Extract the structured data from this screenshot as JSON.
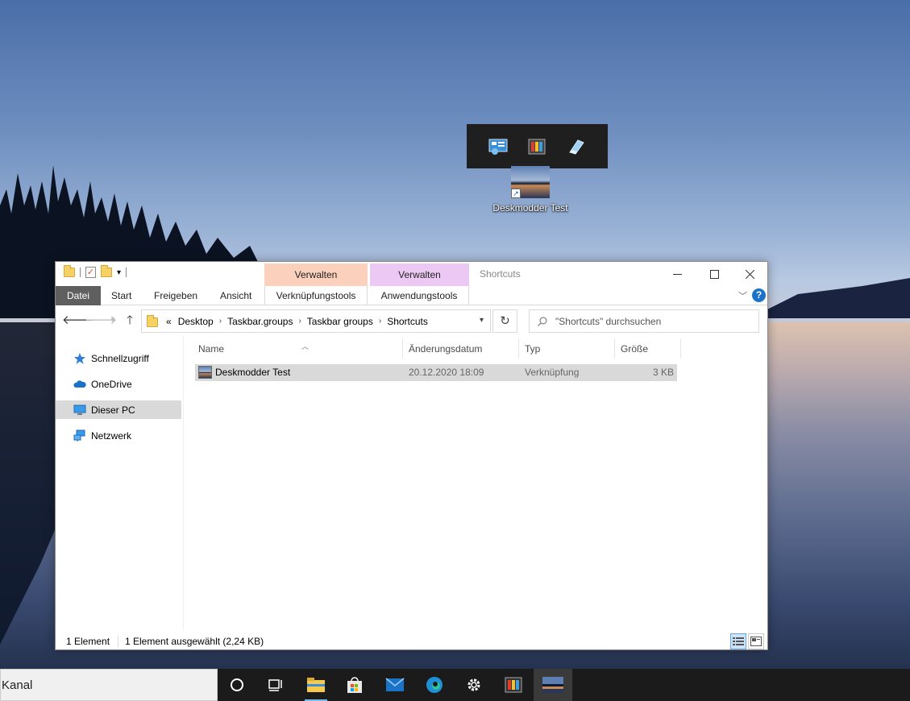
{
  "desktop": {
    "shortcut_label": "Deskmodder Test"
  },
  "window": {
    "title": "Shortcuts",
    "context_tabs": [
      {
        "header": "Verwalten",
        "label": "Verknüpfungstools",
        "color": "#fbd0bd"
      },
      {
        "header": "Verwalten",
        "label": "Anwendungstools",
        "color": "#ecc9f4"
      }
    ],
    "ribbon_tabs": [
      "Datei",
      "Start",
      "Freigeben",
      "Ansicht"
    ],
    "help": "?"
  },
  "address": {
    "prefix": "«",
    "crumbs": [
      "Desktop",
      "Taskbar.groups",
      "Taskbar groups",
      "Shortcuts"
    ]
  },
  "search": {
    "placeholder": "\"Shortcuts\" durchsuchen"
  },
  "sidebar": {
    "items": [
      {
        "label": "Schnellzugriff",
        "icon": "star-icon"
      },
      {
        "label": "OneDrive",
        "icon": "cloud-icon"
      },
      {
        "label": "Dieser PC",
        "icon": "computer-icon",
        "selected": true
      },
      {
        "label": "Netzwerk",
        "icon": "network-icon"
      }
    ]
  },
  "filelist": {
    "columns": [
      "Name",
      "Änderungsdatum",
      "Typ",
      "Größe"
    ],
    "rows": [
      {
        "name": "Deskmodder Test",
        "date": "20.12.2020 18:09",
        "type": "Verknüpfung",
        "size": "3 KB"
      }
    ]
  },
  "status": {
    "count": "1 Element",
    "selected": "1 Element ausgewählt (2,24 KB)"
  },
  "taskbar": {
    "search_text": "Kanal",
    "accent": "#76b9ed"
  }
}
